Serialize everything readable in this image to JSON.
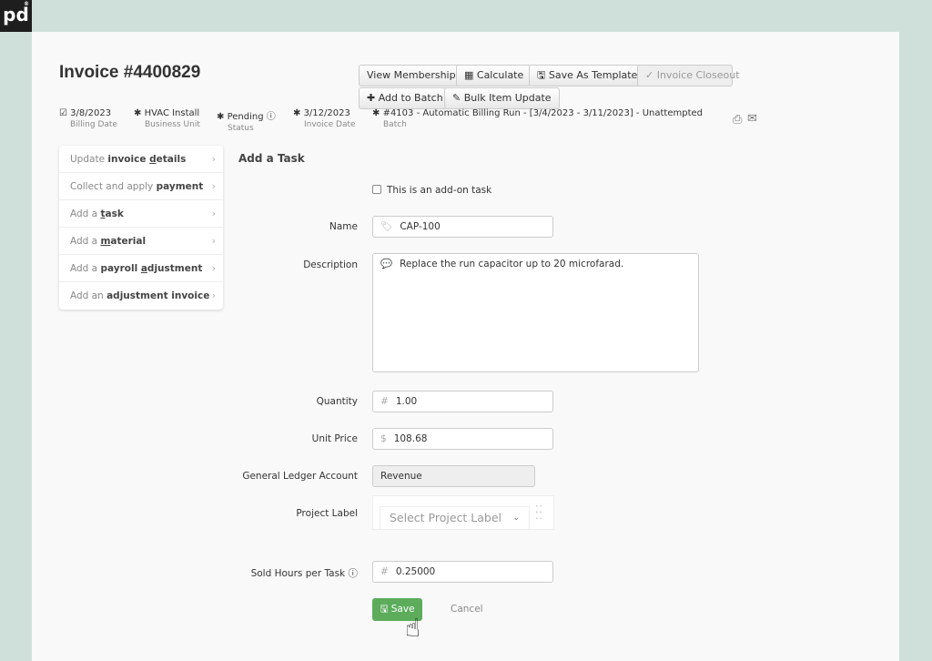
{
  "logo": "pd",
  "header": {
    "title": "Invoice #4400829"
  },
  "toolbar": {
    "view_membership": "View Membership",
    "calculate": "Calculate",
    "save_template": "Save As Template",
    "closeout": "Invoice Closeout",
    "add_batch": "Add to Batch",
    "bulk_update": "Bulk Item Update"
  },
  "meta": [
    {
      "value": "3/8/2023",
      "label": "Billing Date"
    },
    {
      "value": "HVAC Install",
      "label": "Business Unit"
    },
    {
      "value": "Pending",
      "label": "Status"
    },
    {
      "value": "3/12/2023",
      "label": "Invoice Date"
    },
    {
      "value": "#4103 - Automatic Billing Run - [3/4/2023 - 3/11/2023] - Unattempted",
      "label": "Batch"
    }
  ],
  "sidebar": [
    {
      "pre": "Update ",
      "b1": "invoice ",
      "u": "d",
      "b2": "etails"
    },
    {
      "pre": "Collect and apply ",
      "b1": "payment",
      "u": "",
      "b2": ""
    },
    {
      "pre": "Add a ",
      "b1": "",
      "u": "t",
      "b2": "ask"
    },
    {
      "pre": "Add a ",
      "b1": "",
      "u": "m",
      "b2": "aterial"
    },
    {
      "pre": "Add a ",
      "b1": "payroll ",
      "u": "a",
      "b2": "djustment"
    },
    {
      "pre": "Add an ",
      "b1": "adjustment invoice",
      "u": "",
      "b2": ""
    }
  ],
  "form": {
    "title": "Add a Task",
    "addon_label": "This is an add-on task",
    "name_label": "Name",
    "name_value": "CAP-100",
    "desc_label": "Description",
    "desc_value": "Replace the run capacitor up to 20 microfarad.",
    "qty_label": "Quantity",
    "qty_value": "1.00",
    "price_label": "Unit Price",
    "price_value": "108.68",
    "gl_label": "General Ledger Account",
    "gl_value": "Revenue",
    "project_label": "Project Label",
    "project_placeholder": "Select Project Label",
    "hours_label": "Sold Hours per Task",
    "hours_value": "0.25000",
    "save": "Save",
    "cancel": "Cancel"
  }
}
